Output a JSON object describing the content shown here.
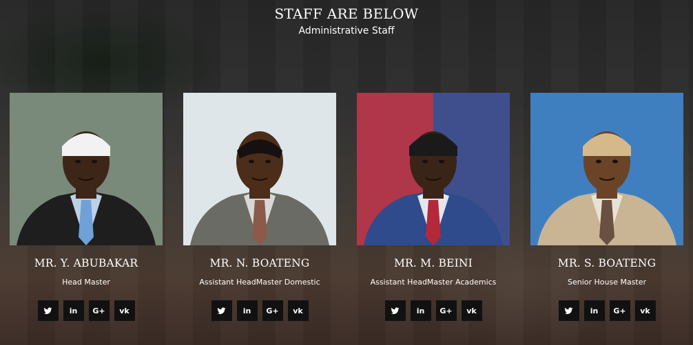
{
  "header": {
    "title": "STAFF ARE BELOW",
    "subtitle": "Administrative Staff"
  },
  "staff": [
    {
      "name": "MR. Y. ABUBAKAR",
      "role": "Head Master",
      "photo": {
        "bg": "#7a8a7a",
        "skin": "#3d2617",
        "hat": "#f2f2f2",
        "jacket": "#1e1e1e",
        "shirt": "#bcd0e6",
        "tie": "#6fa0d8"
      }
    },
    {
      "name": "MR. N. BOATENG",
      "role": "Assistant HeadMaster Domestic",
      "photo": {
        "bg": "#dfe6ea",
        "skin": "#4b2d1a",
        "hat": "",
        "jacket": "#6b6b66",
        "shirt": "#d8d8d8",
        "tie": "#8a5a4a"
      }
    },
    {
      "name": "MR. M. BEINI",
      "role": "Assistant HeadMaster Academics",
      "photo": {
        "bg": "#b0364a",
        "skin": "#3a2417",
        "hat": "#1a1a1a",
        "jacket": "#2f4b8c",
        "shirt": "#e4e6ee",
        "tie": "#b4283a"
      }
    },
    {
      "name": "MR. S. BOATENG",
      "role": "Senior House Master",
      "photo": {
        "bg": "#3f7fc0",
        "skin": "#6b4428",
        "hat": "#d6b98a",
        "jacket": "#c9b493",
        "shirt": "#e8e2d4",
        "tie": "#6a5040"
      }
    }
  ],
  "social": {
    "twitter": "twitter-icon",
    "linkedin": "in",
    "googleplus": "G+",
    "vk": "vk"
  }
}
